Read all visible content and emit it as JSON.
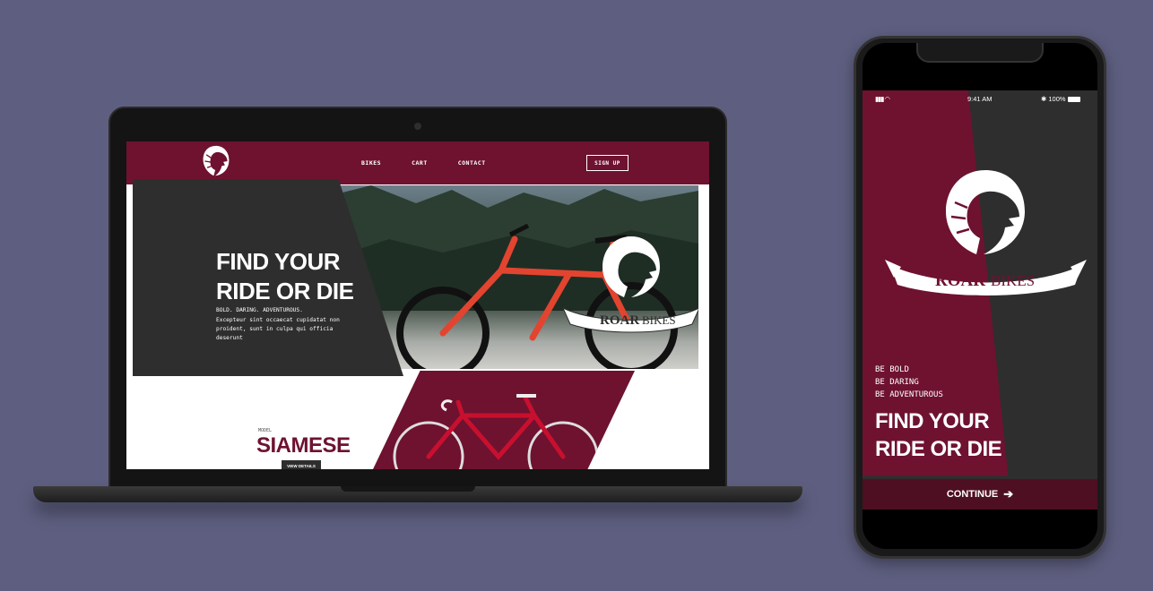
{
  "colors": {
    "background": "#5e5f80",
    "brand_maroon": "#6e1230",
    "panel_dark": "#2e2e2e",
    "button_dark": "#4e0f22"
  },
  "desktop": {
    "nav": [
      "BIKES",
      "CART",
      "CONTACT"
    ],
    "signup_label": "SIGN UP",
    "hero": {
      "title_line1": "FIND YOUR",
      "title_line2": "RIDE OR DIE",
      "tagline": "BOLD. DARING. ADVENTUROUS.",
      "body": "Excepteur sint occaecat cupidatat non proident, sunt in culpa qui officia deserunt"
    },
    "brand_word1": "ROAR",
    "brand_word2": "BIKES",
    "model_label": "MODEL",
    "model_name": "SIAMESE",
    "view_details_label": "VIEW DETAILS"
  },
  "mobile": {
    "status": {
      "time": "9:41 AM",
      "battery": "100%"
    },
    "brand_word1": "ROAR",
    "brand_word2": "BIKES",
    "slogan": [
      "BE BOLD",
      "BE DARING",
      "BE ADVENTUROUS"
    ],
    "title_line1": "FIND YOUR",
    "title_line2": "RIDE OR DIE",
    "continue_label": "CONTINUE"
  },
  "icons": [
    "lion-logo-icon",
    "signal-icon",
    "wifi-icon",
    "bluetooth-icon",
    "battery-icon",
    "arrow-right-icon"
  ]
}
